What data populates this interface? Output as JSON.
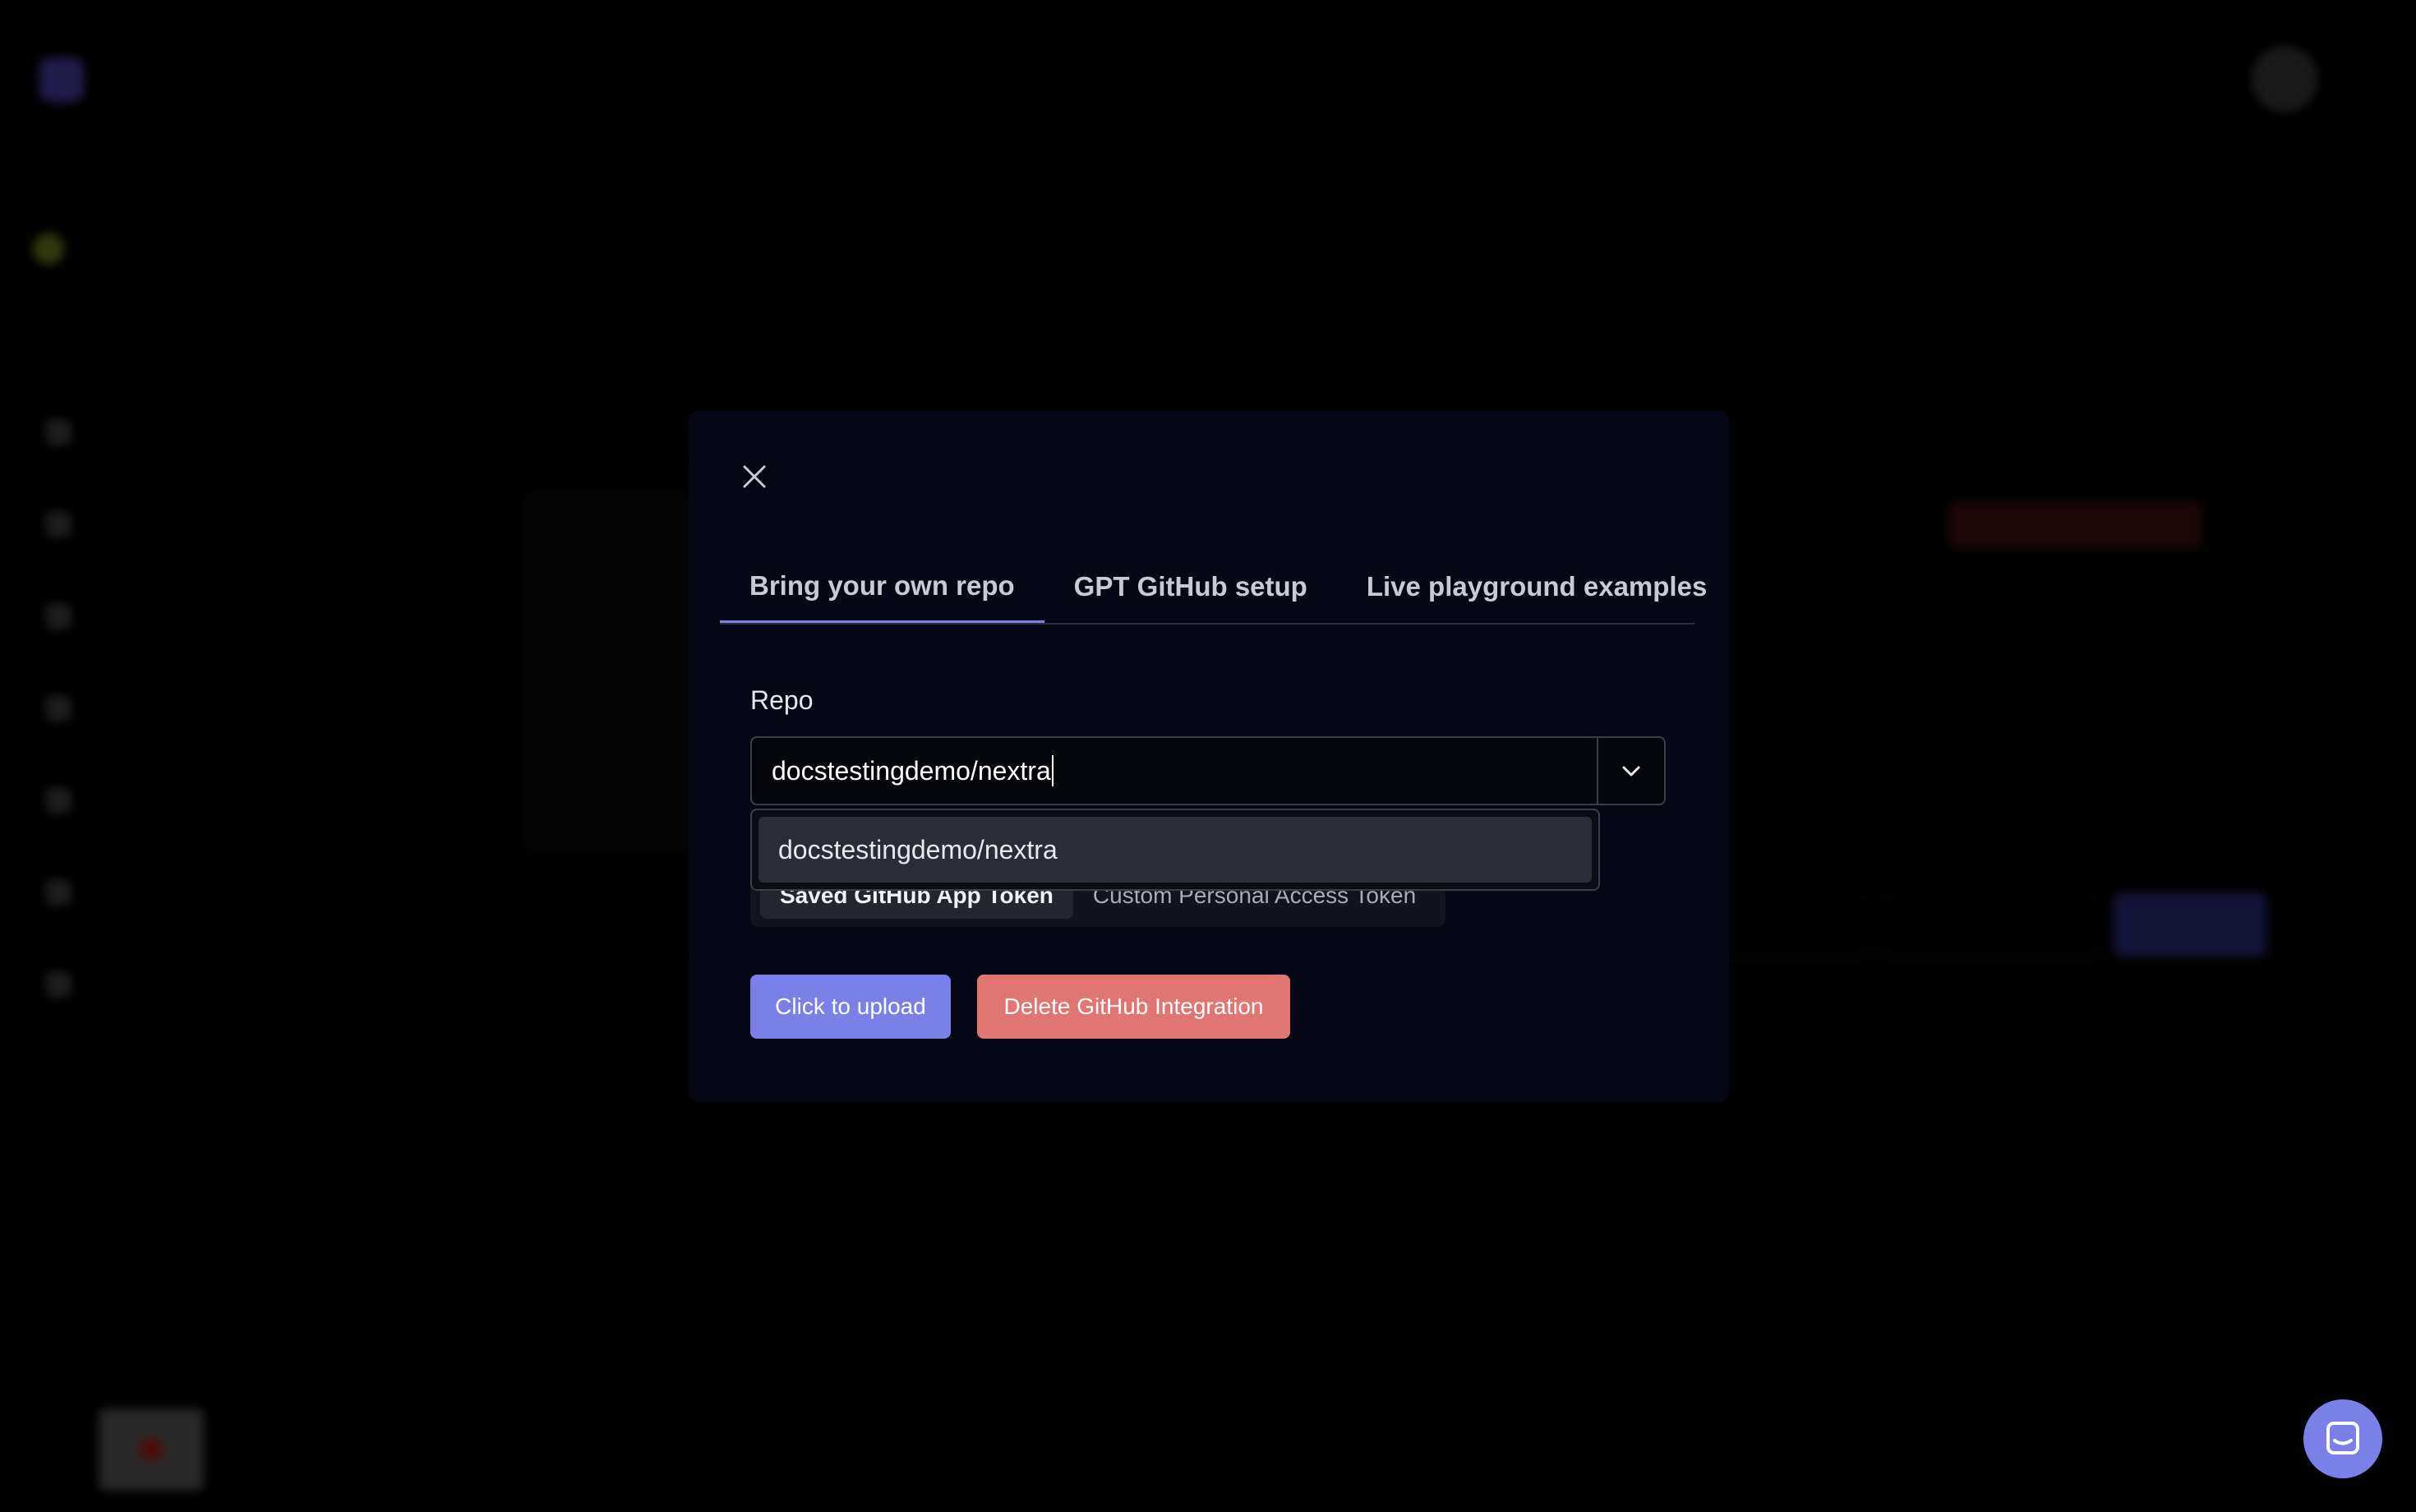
{
  "modal": {
    "tabs": [
      {
        "label": "Bring your own repo",
        "active": true
      },
      {
        "label": "GPT GitHub setup",
        "active": false
      },
      {
        "label": "Live playground examples",
        "active": false
      }
    ],
    "repo_label": "Repo",
    "repo_value": "docstestingdemo/nextra",
    "dropdown_options": [
      "docstestingdemo/nextra"
    ],
    "token_options": [
      {
        "label": "Saved GitHub App Token",
        "active": true
      },
      {
        "label": "Custom Personal Access Token",
        "active": false
      }
    ],
    "upload_button": "Click to upload",
    "delete_button": "Delete GitHub Integration"
  },
  "colors": {
    "modal_bg": "#050814",
    "accent": "#7b80e8",
    "danger": "#e07571"
  },
  "icons": {
    "close": "close-icon",
    "dropdown": "chevron-down-icon",
    "chat": "chat-icon"
  }
}
